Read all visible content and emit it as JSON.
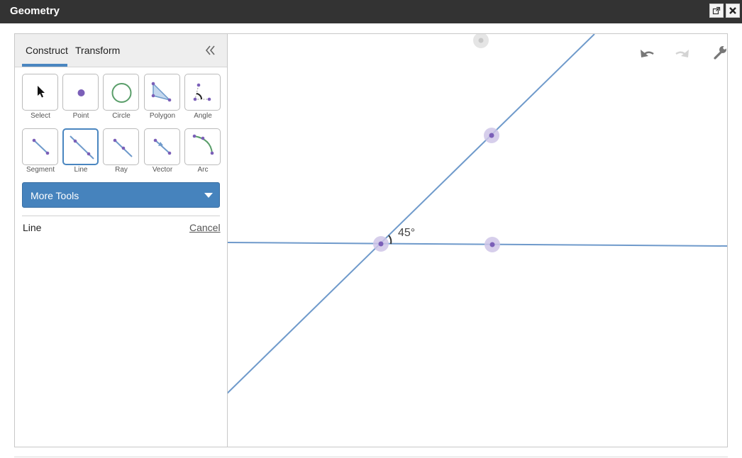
{
  "window": {
    "title": "Geometry"
  },
  "tabs": {
    "construct": "Construct",
    "transform": "Transform"
  },
  "tools": {
    "select": "Select",
    "point": "Point",
    "circle": "Circle",
    "polygon": "Polygon",
    "angle": "Angle",
    "segment": "Segment",
    "line": "Line",
    "ray": "Ray",
    "vector": "Vector",
    "arc": "Arc"
  },
  "more_tools": "More Tools",
  "active_tool": {
    "name": "Line",
    "cancel": "Cancel"
  },
  "canvas": {
    "angle_label": "45°"
  },
  "colors": {
    "accent": "#4a86c0",
    "point": "#7b5fb8",
    "line": "#6f9acb"
  }
}
